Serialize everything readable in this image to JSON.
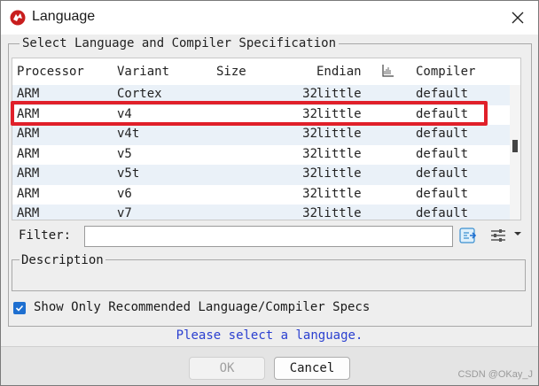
{
  "window": {
    "title": "Language"
  },
  "group": {
    "legend": "Select Language and Compiler Specification"
  },
  "table": {
    "headers": {
      "processor": "Processor",
      "variant": "Variant",
      "size": "Size",
      "endian": "Endian",
      "compiler": "Compiler"
    },
    "rows": [
      {
        "processor": "ARM",
        "variant": "Cortex",
        "size": "32",
        "endian": "little",
        "compiler": "default"
      },
      {
        "processor": "ARM",
        "variant": "v4",
        "size": "32",
        "endian": "little",
        "compiler": "default"
      },
      {
        "processor": "ARM",
        "variant": "v4t",
        "size": "32",
        "endian": "little",
        "compiler": "default"
      },
      {
        "processor": "ARM",
        "variant": "v5",
        "size": "32",
        "endian": "little",
        "compiler": "default"
      },
      {
        "processor": "ARM",
        "variant": "v5t",
        "size": "32",
        "endian": "little",
        "compiler": "default"
      },
      {
        "processor": "ARM",
        "variant": "v6",
        "size": "32",
        "endian": "little",
        "compiler": "default"
      },
      {
        "processor": "ARM",
        "variant": "v7",
        "size": "32",
        "endian": "little",
        "compiler": "default"
      }
    ],
    "highlighted_row_index": 1
  },
  "filter": {
    "label": "Filter:",
    "value": ""
  },
  "description": {
    "legend": "Description"
  },
  "recommended": {
    "label": "Show Only Recommended Language/Compiler Specs",
    "checked": true
  },
  "status": {
    "text": "Please select a language."
  },
  "buttons": {
    "ok": "OK",
    "cancel": "Cancel"
  },
  "watermark": "CSDN @OKay_J",
  "colors": {
    "highlight": "#e0202a",
    "status_text": "#2a3fd0",
    "checkbox": "#1e6fd0",
    "row_alt": "#eaf1f8"
  }
}
